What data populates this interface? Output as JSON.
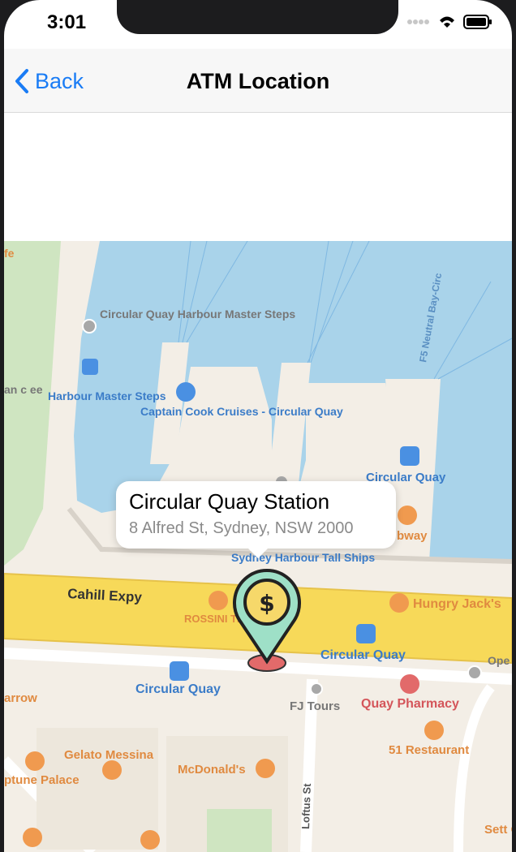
{
  "status": {
    "time": "3:01"
  },
  "nav": {
    "back_label": "Back",
    "title": "ATM Location"
  },
  "callout": {
    "title": "Circular Quay Station",
    "address": "8 Alfred St, Sydney, NSW 2000"
  },
  "map_labels": {
    "harbour_steps": "Circular Quay Harbour Master Steps",
    "harbour_master": "Harbour Master Steps",
    "captain_cook": "Captain Cook Cruises - Circular Quay",
    "neutral_bay": "F5 Neutral Bay-Circ",
    "circular_quay_ferry": "Circular Quay",
    "subway": "bway",
    "sydney_harbour": "Sydney Harbour Tall Ships",
    "cahill": "Cahill Expy",
    "rossini": "ROSSINI THE QUAY",
    "hungry_jacks": "Hungry Jack's",
    "circular_quay_station": "Circular Quay",
    "circular_quay_tram": "Circular Quay",
    "fj_tours": "FJ Tours",
    "quay_pharmacy": "Quay Pharmacy",
    "restaurant_51": "51 Restaurant",
    "gelato": "Gelato Messina",
    "mcdonalds": "McDonald's",
    "neptune": "ptune Palace",
    "arrow": "arrow",
    "loftus": "Loftus St",
    "fe": "fe",
    "left_edge": "an c ee",
    "ope": "Ope Con Sto",
    "sett": "Sett Or"
  },
  "colors": {
    "water": "#a9d3ea",
    "road_yellow": "#f7d959",
    "land": "#f3eee6",
    "park": "#cfe5c1",
    "accent": "#1a7cf5",
    "poi_orange": "#f09a4f"
  }
}
